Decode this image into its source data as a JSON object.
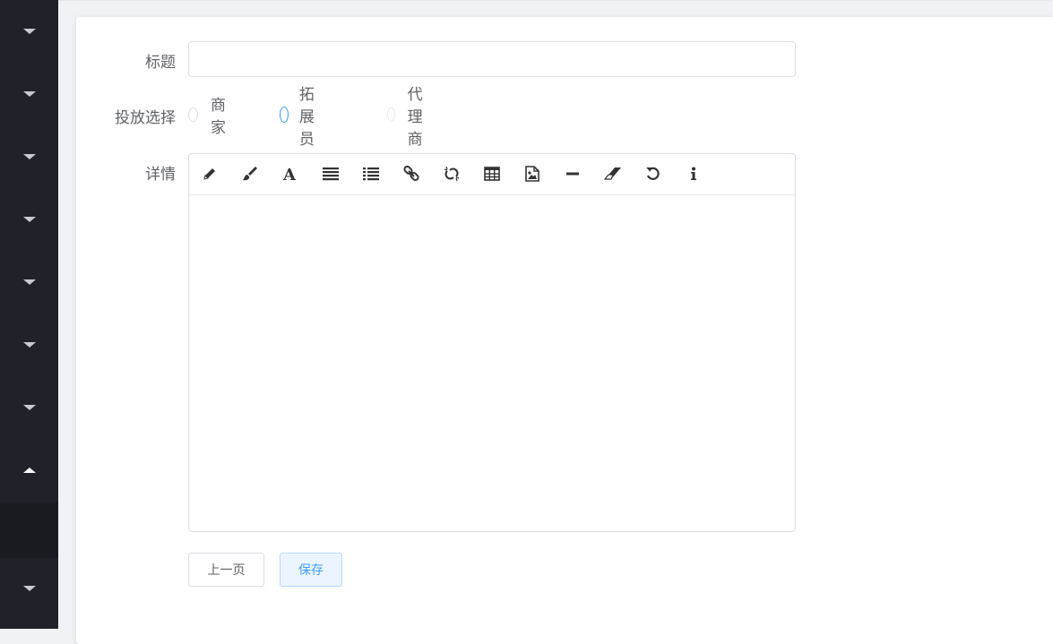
{
  "sidebar": {
    "items": [
      {
        "icon": "caret-down-icon"
      },
      {
        "icon": "caret-down-icon"
      },
      {
        "icon": "caret-down-icon"
      },
      {
        "icon": "caret-down-icon"
      },
      {
        "icon": "caret-down-icon"
      },
      {
        "icon": "caret-down-icon"
      },
      {
        "icon": "caret-down-icon"
      },
      {
        "icon": "caret-up-icon",
        "expanded": true
      },
      {
        "icon": "caret-down-icon"
      }
    ],
    "colors": {
      "background": "#1f2229",
      "active": "#191b20"
    }
  },
  "form": {
    "title_label": "标题",
    "title_value": "",
    "title_placeholder": "",
    "target_label": "投放选择",
    "target_options": [
      "商家",
      "拓展员",
      "代理商"
    ],
    "target_focused": "拓展员",
    "detail_label": "详情",
    "editor_toolbar": [
      "pencil-icon",
      "brush-icon",
      "font-icon",
      "align-justify-icon",
      "list-icon",
      "link-icon",
      "unlink-icon",
      "table-icon",
      "image-icon",
      "horizontal-rule-icon",
      "eraser-icon",
      "undo-icon",
      "info-icon"
    ],
    "editor_content": ""
  },
  "buttons": {
    "prev_label": "上一页",
    "save_label": "保存"
  },
  "colors": {
    "accent": "#409eff",
    "border": "#dcdfe6",
    "text": "#606266"
  }
}
